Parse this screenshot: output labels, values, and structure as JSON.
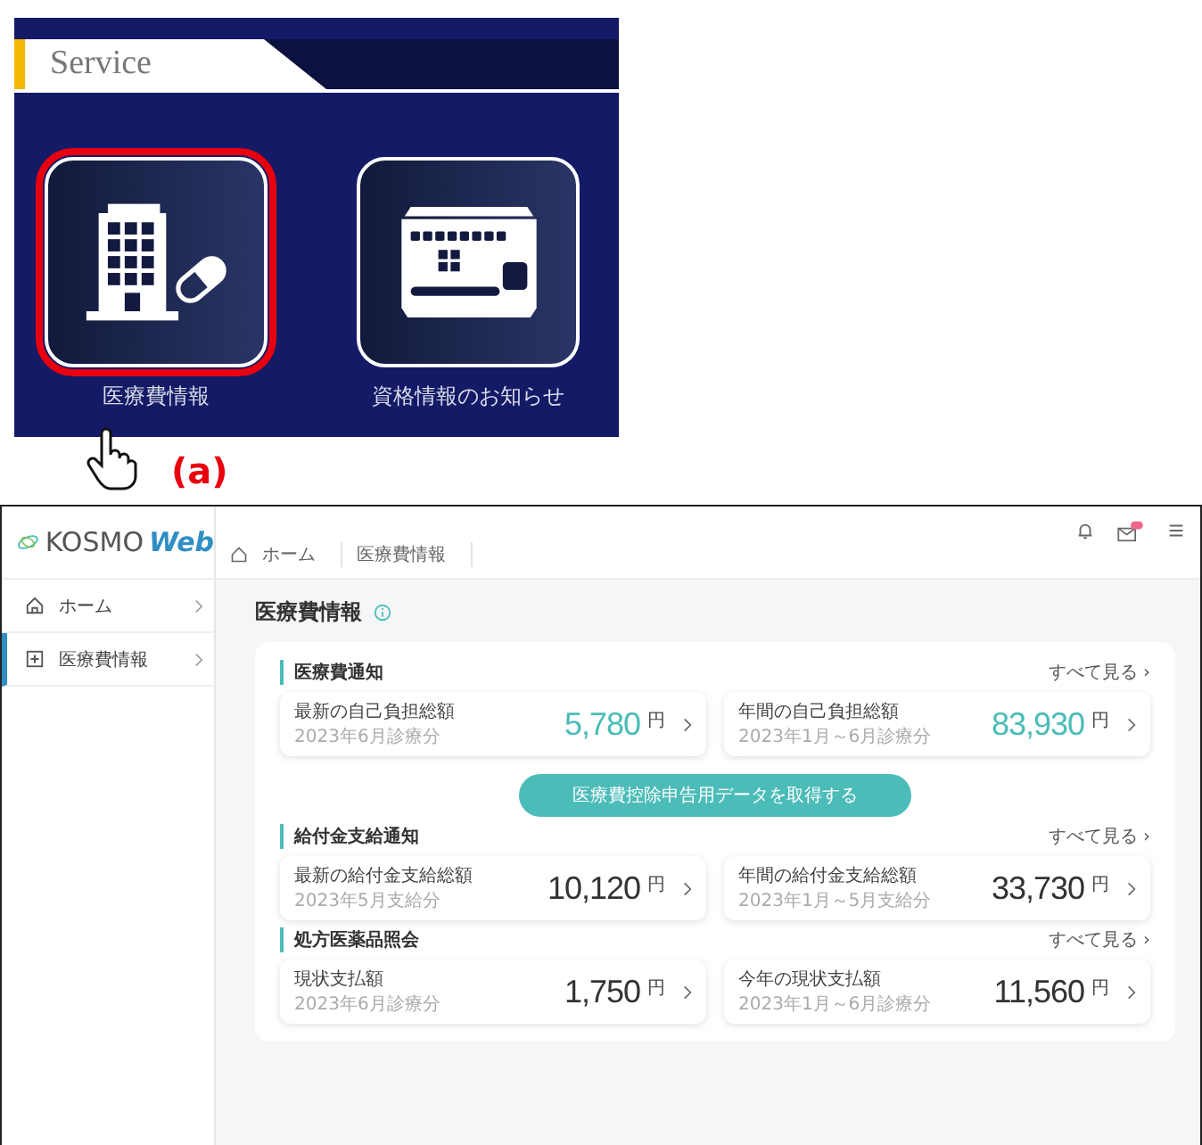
{
  "service_panel": {
    "title": "Service",
    "tiles": [
      {
        "label": "医療費情報",
        "kind": "medical",
        "selected": true
      },
      {
        "label": "資格情報のお知らせ",
        "kind": "card",
        "selected": false
      }
    ]
  },
  "figure_label": "(a)",
  "web": {
    "logo": {
      "name": "KOSMO",
      "accent": "Web"
    },
    "breadcrumb": [
      "ホーム",
      "医療費情報"
    ],
    "sidebar": [
      {
        "label": "ホーム",
        "kind": "home",
        "selected": false
      },
      {
        "label": "医療費情報",
        "kind": "plus",
        "selected": true
      }
    ],
    "page_title": "医療費情報",
    "sections": [
      {
        "title": "医療費通知",
        "see_all": "すべて見る ›",
        "emphasized": true,
        "items": [
          {
            "label": "最新の自己負担総額",
            "period": "2023年6月診療分",
            "amount": "5,780",
            "unit": "円"
          },
          {
            "label": "年間の自己負担総額",
            "period": "2023年1月～6月診療分",
            "amount": "83,930",
            "unit": "円"
          }
        ],
        "action": "医療費控除申告用データを取得する"
      },
      {
        "title": "給付金支給通知",
        "see_all": "すべて見る ›",
        "emphasized": false,
        "items": [
          {
            "label": "最新の給付金支給総額",
            "period": "2023年5月支給分",
            "amount": "10,120",
            "unit": "円"
          },
          {
            "label": "年間の給付金支給総額",
            "period": "2023年1月～5月支給分",
            "amount": "33,730",
            "unit": "円"
          }
        ]
      },
      {
        "title": "処方医薬品照会",
        "see_all": "すべて見る ›",
        "emphasized": false,
        "items": [
          {
            "label": "現状支払額",
            "period": "2023年6月診療分",
            "amount": "1,750",
            "unit": "円"
          },
          {
            "label": "今年の現状支払額",
            "period": "2023年1月～6月診療分",
            "amount": "11,560",
            "unit": "円"
          }
        ]
      }
    ]
  }
}
